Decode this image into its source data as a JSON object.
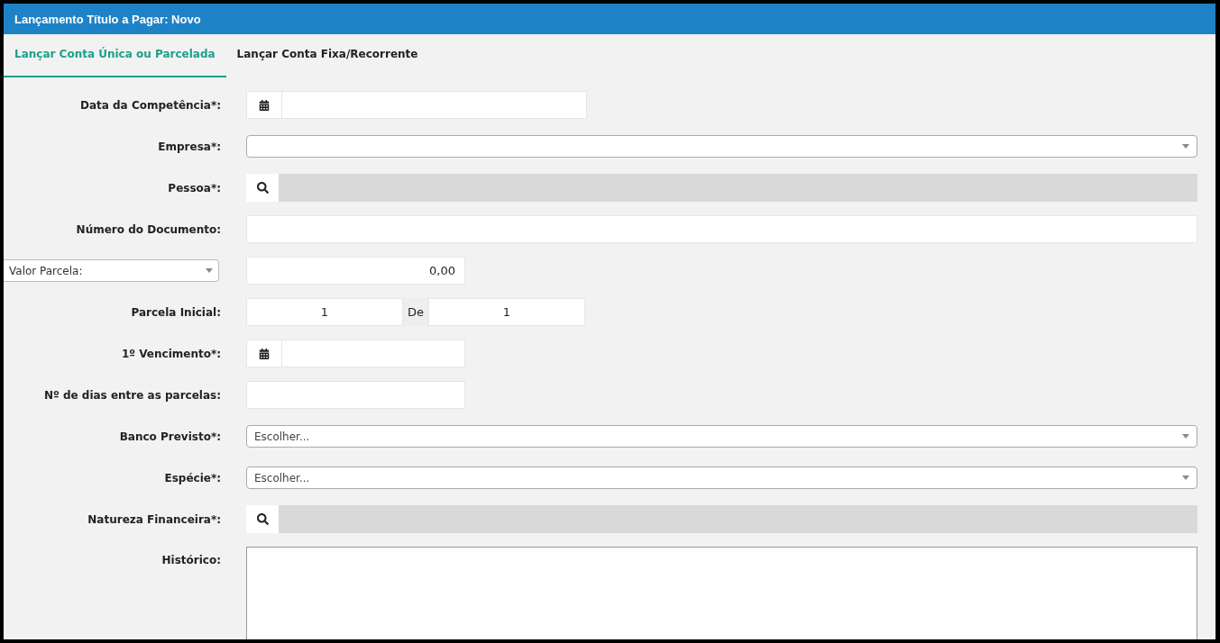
{
  "window": {
    "title": "Lançamento Título a Pagar: Novo"
  },
  "tabs": [
    {
      "label": "Lançar Conta Única ou Parcelada",
      "selected": true
    },
    {
      "label": "Lançar Conta Fixa/Recorrente",
      "selected": false
    }
  ],
  "fields": [
    {
      "kind": "date",
      "label": "Data da Competência*:"
    },
    {
      "kind": "select",
      "label": "Empresa*:"
    },
    {
      "kind": "lookup",
      "label": "Pessoa*:"
    },
    {
      "kind": "text",
      "label": "Número do Documento:"
    },
    {
      "kind": "amount",
      "label_select": "Valor Parcela:",
      "value": "0,00"
    },
    {
      "kind": "range",
      "label": "Parcela Inicial:",
      "from": "1",
      "separator": "De",
      "to": "1"
    },
    {
      "kind": "shortdate",
      "label": "1º Vencimento*:"
    },
    {
      "kind": "shorttext",
      "label": "Nº de dias entre as parcelas:"
    },
    {
      "kind": "select",
      "label": "Banco Previsto*:",
      "placeholder": "Escolher..."
    },
    {
      "kind": "select",
      "label": "Espécie*:",
      "placeholder": "Escolher..."
    },
    {
      "kind": "lookup",
      "label": "Natureza Financeira*:"
    },
    {
      "kind": "textarea",
      "label": "Histórico:"
    }
  ]
}
